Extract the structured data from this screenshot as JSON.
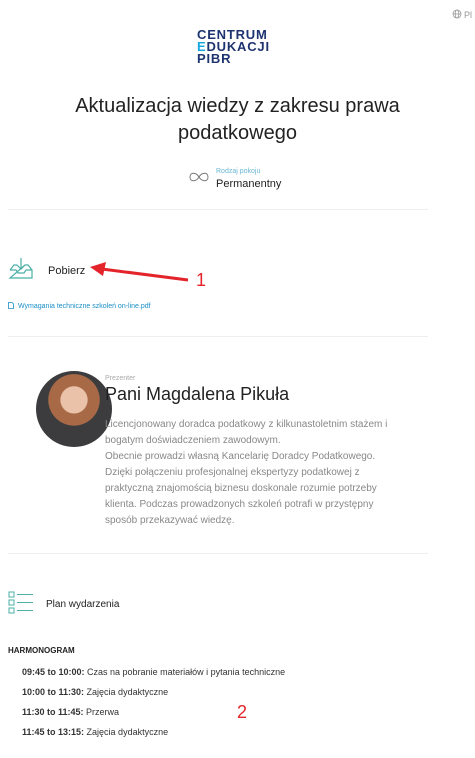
{
  "lang": {
    "label": "Pl"
  },
  "logo": {
    "line1": "CENTRUM",
    "line2_e": "E",
    "line2_rest": "DUKACJI",
    "line3": "PIBR"
  },
  "title": "Aktualizacja wiedzy z zakresu prawa podatkowego",
  "room": {
    "label": "Rodzaj pokoju",
    "value": "Permanentny"
  },
  "download": {
    "label": "Pobierz",
    "file": "Wymagania techniczne szkoleń on-line.pdf"
  },
  "presenter": {
    "role": "Prezenter",
    "name": "Pani Magdalena Pikuła",
    "bio1": "Licencjonowany doradca podatkowy z kilkunastoletnim stażem i bogatym doświadczeniem zawodowym.",
    "bio2": "Obecnie prowadzi własną Kancelarię Doradcy Podatkowego. Dzięki połączeniu profesjonalnej ekspertyzy podatkowej z praktyczną znajomością biznesu doskonale rozumie potrzeby klienta. Podczas prowadzonych szkoleń potrafi w przystępny sposób przekazywać wiedzę."
  },
  "plan": {
    "label": "Plan wydarzenia"
  },
  "schedule": {
    "heading": "HARMONOGRAM",
    "items": [
      {
        "time": "09:45 to 10:00:",
        "text": " Czas na pobranie materiałów i pytania techniczne"
      },
      {
        "time": "10:00 to 11:30:",
        "text": " Zajęcia dydaktyczne"
      },
      {
        "time": "11:30 to 11:45:",
        "text": " Przerwa"
      },
      {
        "time": "11:45 to 13:15:",
        "text": " Zajęcia dydaktyczne"
      }
    ]
  },
  "annotations": {
    "one": "1",
    "two": "2"
  },
  "colors": {
    "accent": "#1a8fc7",
    "brand": "#1e3470",
    "annotation": "#e4242b"
  }
}
